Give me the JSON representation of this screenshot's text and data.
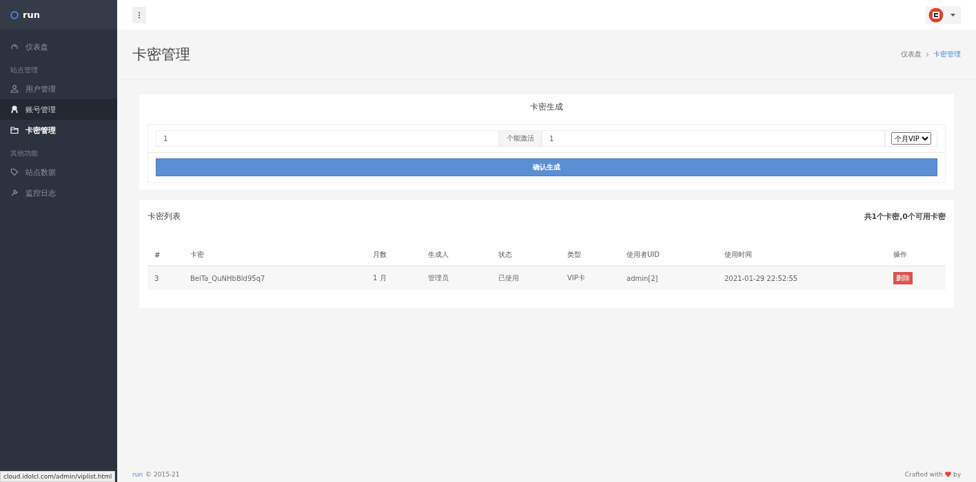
{
  "brand": "run",
  "sidebar": {
    "items": [
      {
        "kind": "link",
        "label": "仪表盘",
        "selected": false,
        "hovered": false
      },
      {
        "kind": "heading",
        "label": "站点管理"
      },
      {
        "kind": "link",
        "label": "用户管理",
        "selected": false,
        "hovered": false
      },
      {
        "kind": "link",
        "label": "账号管理",
        "selected": false,
        "hovered": true
      },
      {
        "kind": "link",
        "label": "卡密管理",
        "selected": true,
        "hovered": false
      },
      {
        "kind": "heading",
        "label": "其他功能"
      },
      {
        "kind": "link",
        "label": "站点数据",
        "selected": false,
        "hovered": false
      },
      {
        "kind": "link",
        "label": "监控日志",
        "selected": false,
        "hovered": false
      }
    ]
  },
  "page_title": "卡密管理",
  "breadcrumb": [
    {
      "label": "仪表盘",
      "selected": false
    },
    {
      "label": "卡密管理",
      "selected": true
    }
  ],
  "generate": {
    "title": "卡密生成",
    "count_value": "1",
    "count_suffix": "个能激活",
    "months_value": "1",
    "type_select": "个月VIP",
    "submit": "确认生成"
  },
  "list": {
    "title": "卡密列表",
    "summary": "共1个卡密,0个可用卡密",
    "columns": [
      "#",
      "卡密",
      "月数",
      "生成人",
      "状态",
      "类型",
      "使用者UID",
      "使用时间",
      "操作"
    ],
    "rows": [
      {
        "cells": [
          "3",
          "BeiTa_QuNHbBld95q7",
          "1 月",
          "管理员",
          "已使用",
          "VIP卡",
          "admin[2]",
          "2021-01-29 22:52:55"
        ],
        "action": "删除"
      }
    ]
  },
  "footer": {
    "brand": "run",
    "copyright": "© 2015-21",
    "crafted": "Crafted with",
    "by": "by"
  },
  "status_url": "cloud.idolcl.com/admin/viplist.html"
}
